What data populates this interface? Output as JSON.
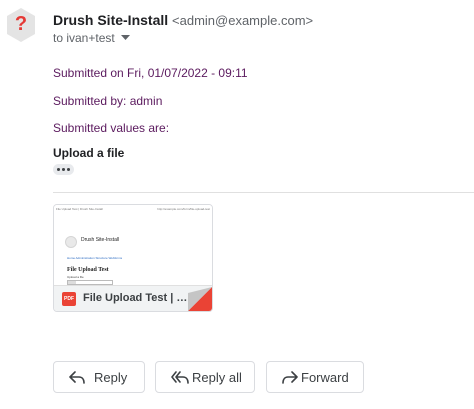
{
  "header": {
    "sender_name": "Drush Site-Install",
    "sender_email": "<admin@example.com>",
    "to_line": "to ivan+test",
    "avatar_glyph": "?",
    "avatar_color": "#e53935"
  },
  "body": {
    "submitted_on": "Submitted on Fri, 01/07/2022 - 09:11",
    "submitted_by": "Submitted by: admin",
    "submitted_values": "Submitted values are:",
    "upload_heading": "Upload a file",
    "text_color": "#5b1a5e"
  },
  "attachment": {
    "file_type": "PDF",
    "file_name": "File Upload Test | D...",
    "preview": {
      "header_left": "File Upload Test | Drush Site-Install",
      "header_right": "http://example.com/form/file-upload-test",
      "site_name": "Drush Site-Install",
      "links": "Home  Administration  Structure  Webforms",
      "heading": "File Upload Test",
      "field_label": "Upload a file",
      "file_status": "Browse...  No file selected."
    }
  },
  "actions": {
    "reply": "Reply",
    "reply_all": "Reply all",
    "forward": "Forward"
  }
}
